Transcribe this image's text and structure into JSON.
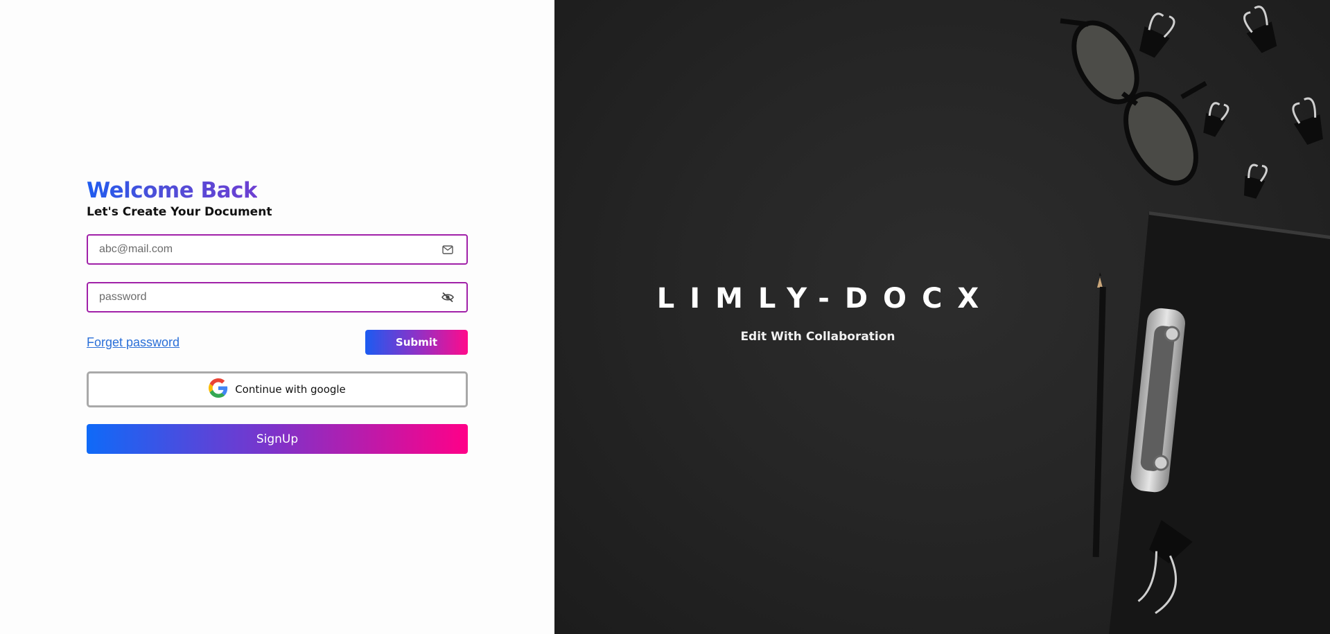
{
  "login": {
    "title": "Welcome Back",
    "subtitle": "Let's Create Your Document",
    "email": {
      "placeholder": "abc@mail.com",
      "icon": "mail-icon"
    },
    "password": {
      "placeholder": "password",
      "icon": "eye-off-icon"
    },
    "forgot_label": "Forget password",
    "submit_label": "Submit",
    "google_label": "Continue with google",
    "signup_label": "SignUp"
  },
  "hero": {
    "brand": "LIMLY-DOCX",
    "tagline": "Edit With Collaboration"
  },
  "colors": {
    "field_border": "#a020a8",
    "gradient_start": "#1c5bf1",
    "gradient_end": "#ff0b8b",
    "link": "#2a6fd8",
    "hero_bg": "#262626"
  }
}
